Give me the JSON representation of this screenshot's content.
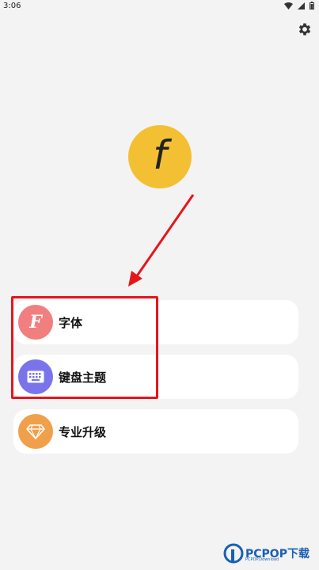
{
  "status_bar": {
    "time": "3:06"
  },
  "logo": {
    "letter": "f"
  },
  "menu": [
    {
      "label": "字体",
      "icon": "font-icon",
      "color": "#f17f7f"
    },
    {
      "label": "键盘主题",
      "icon": "keyboard-icon",
      "color": "#7a74ec"
    },
    {
      "label": "专业升级",
      "icon": "diamond-icon",
      "color": "#f0a04a"
    }
  ],
  "annotation": {
    "box_color": "#e4161c",
    "arrow_color": "#e4161c"
  },
  "watermark": {
    "text": "PCPOP下载",
    "sub": "PCPOP.Download"
  }
}
